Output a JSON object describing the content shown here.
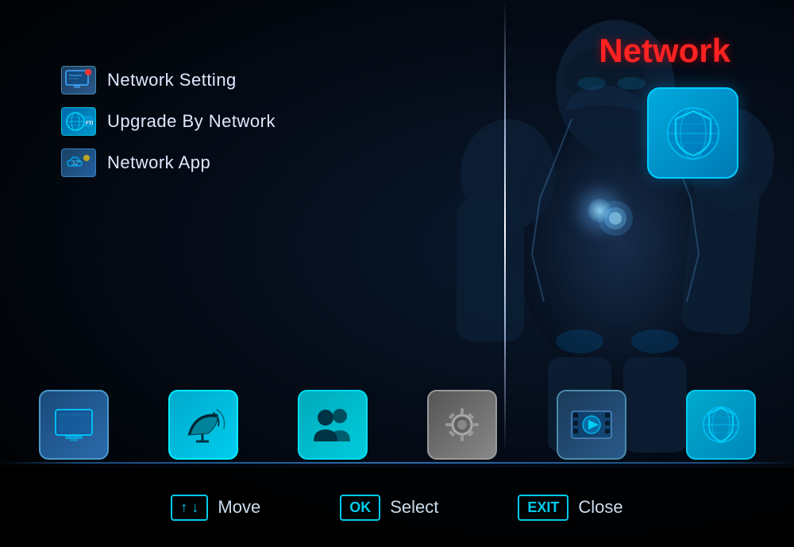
{
  "title": "Network",
  "menu": {
    "items": [
      {
        "id": "network-setting",
        "label": "Network Setting",
        "icon_type": "network-setting"
      },
      {
        "id": "upgrade-by-network",
        "label": "Upgrade By Network",
        "icon_type": "upgrade"
      },
      {
        "id": "network-app",
        "label": "Network App",
        "icon_type": "network-app"
      }
    ]
  },
  "dock": {
    "icons": [
      {
        "id": "tv",
        "label": "TV"
      },
      {
        "id": "satellite",
        "label": "Satellite"
      },
      {
        "id": "users",
        "label": "Users"
      },
      {
        "id": "settings",
        "label": "Settings"
      },
      {
        "id": "media",
        "label": "Media"
      },
      {
        "id": "network2",
        "label": "Network"
      }
    ]
  },
  "controls": [
    {
      "key": "↑ ↓",
      "action": "Move"
    },
    {
      "key": "OK",
      "action": "Select"
    },
    {
      "key": "EXIT",
      "action": "Close"
    }
  ],
  "colors": {
    "accent": "#00ccee",
    "red": "#ff2222",
    "dark_bg": "#000814"
  }
}
